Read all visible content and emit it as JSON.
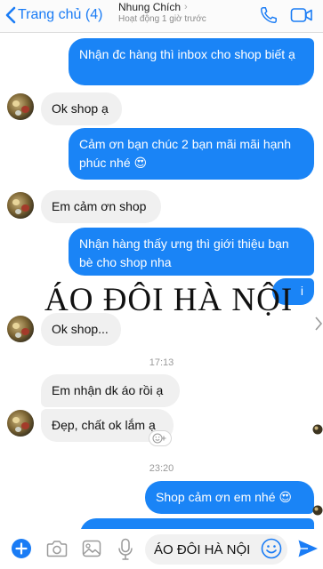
{
  "header": {
    "back_label": "Trang chủ (4)",
    "contact_name": "Nhung Chích",
    "status": "Hoạt động 1 giờ trước",
    "accent": "#1a7cf5"
  },
  "messages": [
    {
      "id": "m1",
      "dir": "out",
      "text": "Nhận đc hàng thì inbox cho shop biết ạ"
    },
    {
      "id": "m2",
      "dir": "in",
      "text": "Ok shop ạ"
    },
    {
      "id": "m3",
      "dir": "out",
      "text": "Cảm ơn bạn chúc 2 bạn mãi mãi hạnh phúc nhé 😍"
    },
    {
      "id": "m4",
      "dir": "in",
      "text": "Em cảm ơn shop"
    },
    {
      "id": "m5",
      "dir": "out",
      "text": "Nhận hàng thấy ưng thì giới thiệu bạn bè cho shop nha"
    },
    {
      "id": "m5b",
      "dir": "out",
      "text": "i"
    },
    {
      "id": "m6",
      "dir": "in",
      "text": "Ok shop..."
    },
    {
      "id": "t1",
      "type": "time",
      "text": "17:13"
    },
    {
      "id": "m7",
      "dir": "in",
      "text": "Em nhận dk áo rồi ạ"
    },
    {
      "id": "m8",
      "dir": "in",
      "text": "Đẹp, chất ok lắm ạ"
    },
    {
      "id": "t2",
      "type": "time",
      "text": "23:20"
    },
    {
      "id": "m9",
      "dir": "out",
      "text": "Shop cảm ơn em nhé 😍"
    }
  ],
  "watermark": "ÁO ĐÔI HÀ NỘI",
  "composer": {
    "input_value": "ÁO ĐÔI HÀ NỘI"
  },
  "colors": {
    "outgoing_bubble": "#1a84f6",
    "incoming_bubble": "#f0f0f0"
  }
}
